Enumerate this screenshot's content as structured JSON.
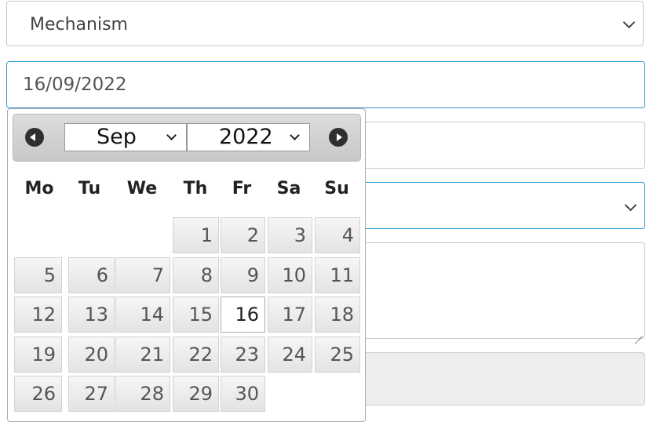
{
  "form": {
    "mechanism_select": {
      "value": "Mechanism"
    },
    "date_input": {
      "value": "16/09/2022"
    }
  },
  "datepicker": {
    "month_selected": "Sep",
    "year_selected": "2022",
    "weekdays": [
      "Mo",
      "Tu",
      "We",
      "Th",
      "Fr",
      "Sa",
      "Su"
    ],
    "days": [
      "1",
      "2",
      "3",
      "4",
      "5",
      "6",
      "7",
      "8",
      "9",
      "10",
      "11",
      "12",
      "13",
      "14",
      "15",
      "16",
      "17",
      "18",
      "19",
      "20",
      "21",
      "22",
      "23",
      "24",
      "25",
      "26",
      "27",
      "28",
      "29",
      "30"
    ],
    "first_weekday_index": 3,
    "selected_day": "16"
  },
  "colors": {
    "accent_border": "#2e9bd1",
    "header_bg": "#cfcfcf",
    "day_bg": "#e9e9e9",
    "selected_day_bg": "#ffffff"
  },
  "icons": {
    "prev": "circle-arrow-left-icon",
    "next": "circle-arrow-right-icon",
    "dropdown": "chevron-down-icon"
  }
}
